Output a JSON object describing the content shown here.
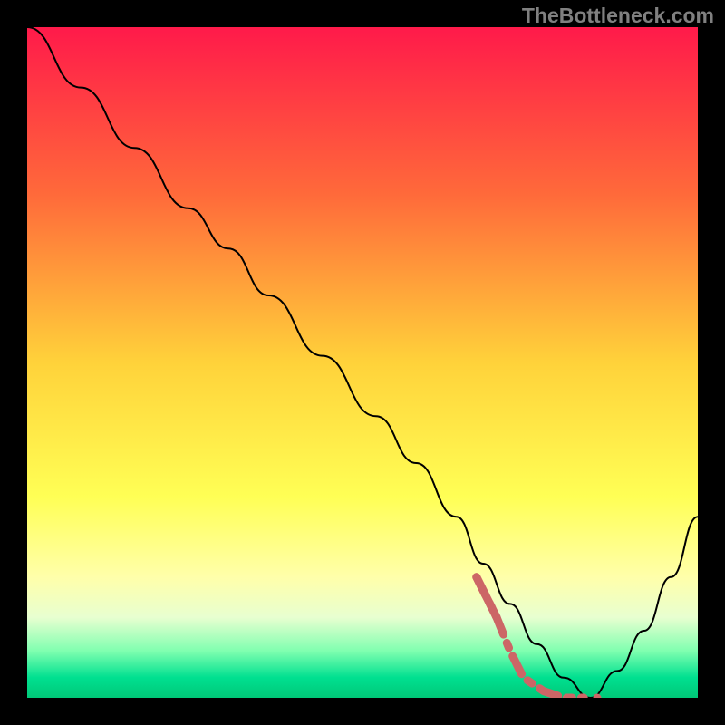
{
  "watermark": "TheBottleneck.com",
  "chart_data": {
    "type": "line",
    "title": "",
    "xlabel": "",
    "ylabel": "",
    "xlim": [
      0,
      100
    ],
    "ylim": [
      0,
      100
    ],
    "gradient_stops": [
      {
        "offset": 0,
        "color": "#ff1a4a"
      },
      {
        "offset": 25,
        "color": "#ff6a3a"
      },
      {
        "offset": 50,
        "color": "#ffd23a"
      },
      {
        "offset": 70,
        "color": "#ffff55"
      },
      {
        "offset": 82,
        "color": "#ffffaa"
      },
      {
        "offset": 88,
        "color": "#e8ffd0"
      },
      {
        "offset": 93,
        "color": "#80ffb0"
      },
      {
        "offset": 97,
        "color": "#00e090"
      },
      {
        "offset": 100,
        "color": "#00c878"
      }
    ],
    "series": [
      {
        "name": "bottleneck-curve",
        "color": "#000000",
        "stroke_width": 2,
        "x": [
          0,
          8,
          16,
          24,
          30,
          36,
          44,
          52,
          58,
          64,
          68,
          72,
          76,
          80,
          84,
          88,
          92,
          96,
          100
        ],
        "y": [
          100,
          91,
          82,
          73,
          67,
          60,
          51,
          42,
          35,
          27,
          20,
          14,
          8,
          3,
          0,
          4,
          10,
          18,
          27
        ]
      },
      {
        "name": "highlight-segment",
        "color": "#cc6666",
        "stroke_width": 9,
        "dash": true,
        "x": [
          67,
          70,
          72,
          74,
          77,
          80,
          83
        ],
        "y": [
          18,
          12,
          7,
          3,
          1,
          0,
          0
        ]
      }
    ]
  }
}
